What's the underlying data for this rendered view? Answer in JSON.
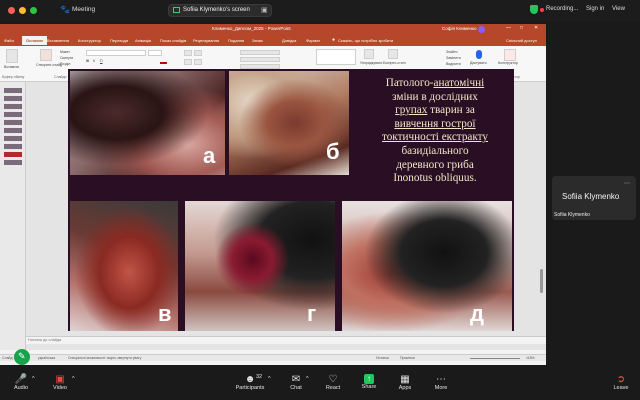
{
  "zoom": {
    "title": "Meeting",
    "share_label": "Sofiia Klymenko's screen",
    "recording_label": "Recording...",
    "signin_label": "Sign in",
    "view_label": "View",
    "toolbar": {
      "audio": "Audio",
      "video": "Video",
      "participants": "Participants",
      "participants_count": "32",
      "chat": "Chat",
      "react": "React",
      "share": "Share",
      "apps": "Apps",
      "more": "More",
      "leave": "Leave"
    },
    "participant_tile": {
      "big_name": "Sofiia Klymenko",
      "small_name": "Sofiia Klymenko"
    }
  },
  "ppt": {
    "title": "Клименко_Диплом_2025 - PowerPoint",
    "user": "Софія Клименко",
    "menu": [
      "Файл",
      "Основне",
      "Вставлення",
      "Конструктор",
      "Переходи",
      "Анімація",
      "Показ слайдів",
      "Рецензування",
      "Подання",
      "Запис",
      "Довідка",
      "Формат"
    ],
    "search_hint": "Скажіть, що потрібно зробити",
    "share_button": "Спільний доступ",
    "ribbon_groups": [
      "Буфер обміну",
      "Слайди",
      "Шрифт",
      "Абзац",
      "Малювання",
      "Редагування",
      "Голос",
      "Конструктор"
    ],
    "ribbon_items": {
      "paste": "Вставити",
      "new_slide": "Створити слайд",
      "layout": "Макет",
      "reset": "Скинути",
      "section": "Розділ",
      "arrange": "Упорядкувати",
      "quick_styles": "Експрес-стилі",
      "find": "Знайти",
      "replace": "Замінити",
      "select": "Виділити",
      "dictate": "Диктувати",
      "designer": "Конструктор"
    },
    "notes_placeholder": "Нотатки до слайда",
    "status": {
      "slide": "Слайд 1 з 1",
      "lang": "українська",
      "accessibility": "Спеціальні можливості: варто звернути увагу",
      "notes": "Нотатки",
      "comments": "Примітки",
      "zoom": "118%"
    }
  },
  "slide": {
    "text_lines": [
      "Патолого-",
      "анатомічні",
      "зміни в дослідних",
      "групах",
      " тварин за",
      "вивчення гострої",
      "токтичності екстракту",
      "базидіального",
      "деревного гриба",
      "Inonotus obliquus."
    ],
    "photo_labels": [
      "а",
      "б",
      "в",
      "г",
      "д"
    ]
  }
}
